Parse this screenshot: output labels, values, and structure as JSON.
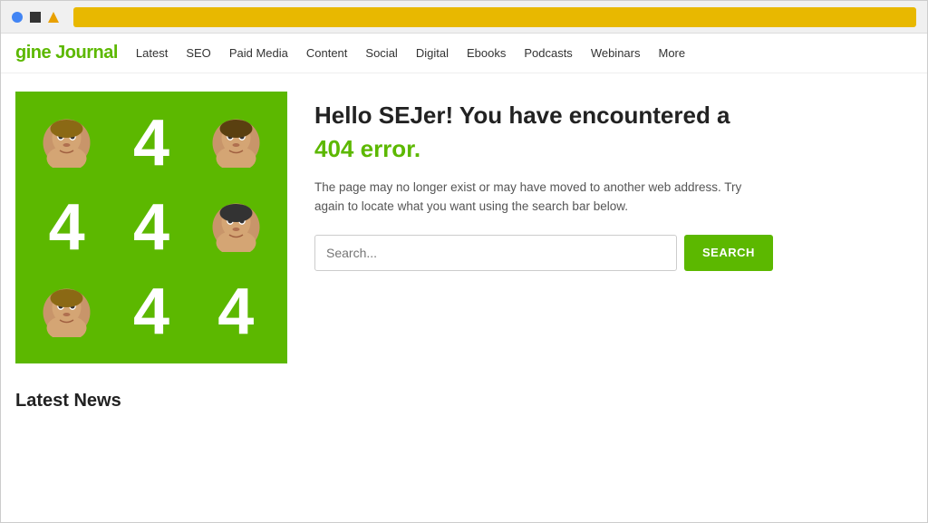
{
  "browser": {
    "address_bar_color": "#e8b800"
  },
  "nav": {
    "logo_prefix": "gine ",
    "logo_suffix": "Journal",
    "items": [
      {
        "label": "Latest"
      },
      {
        "label": "SEO"
      },
      {
        "label": "Paid Media"
      },
      {
        "label": "Content"
      },
      {
        "label": "Social"
      },
      {
        "label": "Digital"
      },
      {
        "label": "Ebooks"
      },
      {
        "label": "Podcasts"
      },
      {
        "label": "Webinars"
      },
      {
        "label": "More"
      }
    ]
  },
  "error_page": {
    "headline": "Hello SEJer! You have encountered a",
    "subheadline": "404 error.",
    "description": "The page may no longer exist or may have moved to another web address. Try again to locate what you want using the search bar below.",
    "search_placeholder": "Search...",
    "search_button_label": "SEARCH"
  },
  "latest_news": {
    "title": "Latest News"
  },
  "icons": {
    "face_color": "#d4a574",
    "four_color": "#ffffff",
    "bg_color": "#5cb800"
  }
}
